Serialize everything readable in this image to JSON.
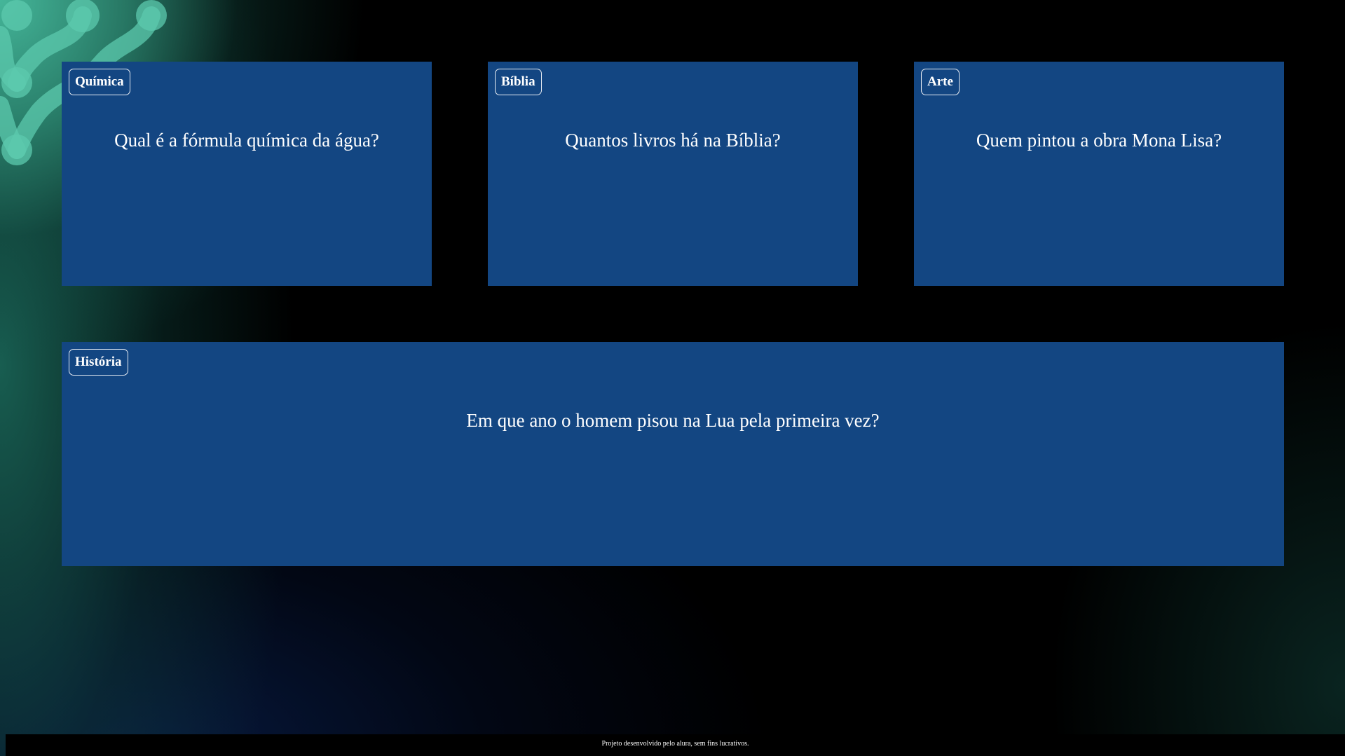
{
  "cards": [
    {
      "tag": "Química",
      "question": "Qual é a fórmula química da água?"
    },
    {
      "tag": "Bíblia",
      "question": "Quantos livros há na Bíblia?"
    },
    {
      "tag": "Arte",
      "question": "Quem pintou a obra Mona Lisa?"
    },
    {
      "tag": "História",
      "question": "Em que ano o homem pisou na Lua pela primeira vez?"
    }
  ],
  "footer": {
    "text": "Projeto desenvolvido pelo alura, sem fins lucrativos."
  },
  "colors": {
    "card_background": "#134682",
    "page_background": "#000000",
    "accent_green": "#4fc3a8",
    "text": "#ffffff"
  },
  "icons": {
    "decor": "molecule-pattern-icon"
  }
}
